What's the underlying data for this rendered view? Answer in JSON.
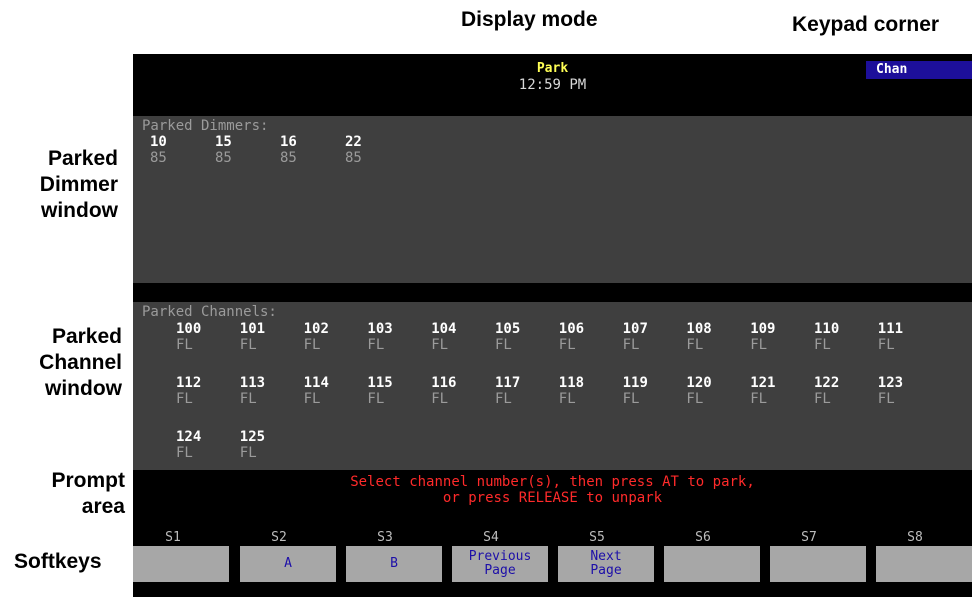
{
  "annotations": {
    "display_mode": "Display mode",
    "keypad_corner": "Keypad corner",
    "parked_dimmer_window": [
      "Parked",
      "Dimmer",
      "window"
    ],
    "parked_channel_window": [
      "Parked",
      "Channel",
      "window"
    ],
    "prompt_area": [
      "Prompt",
      "area"
    ],
    "softkeys": "Softkeys"
  },
  "header": {
    "mode": "Park",
    "time": "12:59 PM",
    "keypad_corner": "Chan"
  },
  "dimmers": {
    "title": "Parked Dimmers:",
    "items": [
      {
        "num": "10",
        "level": "85"
      },
      {
        "num": "15",
        "level": "85"
      },
      {
        "num": "16",
        "level": "85"
      },
      {
        "num": "22",
        "level": "85"
      }
    ]
  },
  "channels": {
    "title": "Parked Channels:",
    "items": [
      {
        "num": "100",
        "level": "FL"
      },
      {
        "num": "101",
        "level": "FL"
      },
      {
        "num": "102",
        "level": "FL"
      },
      {
        "num": "103",
        "level": "FL"
      },
      {
        "num": "104",
        "level": "FL"
      },
      {
        "num": "105",
        "level": "FL"
      },
      {
        "num": "106",
        "level": "FL"
      },
      {
        "num": "107",
        "level": "FL"
      },
      {
        "num": "108",
        "level": "FL"
      },
      {
        "num": "109",
        "level": "FL"
      },
      {
        "num": "110",
        "level": "FL"
      },
      {
        "num": "111",
        "level": "FL"
      },
      {
        "num": "112",
        "level": "FL"
      },
      {
        "num": "113",
        "level": "FL"
      },
      {
        "num": "114",
        "level": "FL"
      },
      {
        "num": "115",
        "level": "FL"
      },
      {
        "num": "116",
        "level": "FL"
      },
      {
        "num": "117",
        "level": "FL"
      },
      {
        "num": "118",
        "level": "FL"
      },
      {
        "num": "119",
        "level": "FL"
      },
      {
        "num": "120",
        "level": "FL"
      },
      {
        "num": "121",
        "level": "FL"
      },
      {
        "num": "122",
        "level": "FL"
      },
      {
        "num": "123",
        "level": "FL"
      },
      {
        "num": "124",
        "level": "FL"
      },
      {
        "num": "125",
        "level": "FL"
      }
    ]
  },
  "prompt": {
    "line1": "Select channel number(s), then press AT to park,",
    "line2": "or press RELEASE to unpark"
  },
  "softkeys": [
    {
      "label": "S1",
      "button": [
        "",
        ""
      ]
    },
    {
      "label": "S2",
      "button": [
        "",
        "A"
      ]
    },
    {
      "label": "S3",
      "button": [
        "",
        "B"
      ]
    },
    {
      "label": "S4",
      "button": [
        "Previous",
        "Page"
      ]
    },
    {
      "label": "S5",
      "button": [
        "Next",
        "Page"
      ]
    },
    {
      "label": "S6",
      "button": [
        "",
        ""
      ]
    },
    {
      "label": "S7",
      "button": [
        "",
        ""
      ]
    },
    {
      "label": "S8",
      "button": [
        "",
        ""
      ]
    }
  ],
  "colors": {
    "screen_bg": "#000000",
    "window_bg": "#3f3f3f",
    "mode_text": "#ffff55",
    "keypad_corner_bg": "#1d0f9a",
    "prompt_text": "#ff2a2a",
    "softkey_bg": "#a7a7a7",
    "softkey_text": "#1d0fa8"
  }
}
